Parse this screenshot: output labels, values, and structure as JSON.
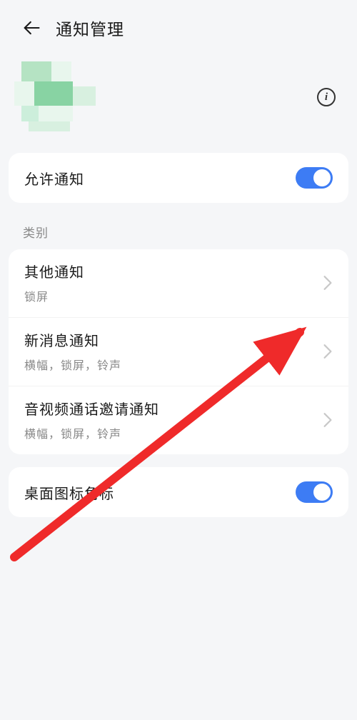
{
  "header": {
    "title": "通知管理"
  },
  "allow_notification": {
    "label": "允许通知",
    "enabled": true
  },
  "category_section_label": "类别",
  "categories": [
    {
      "title": "其他通知",
      "sub": "锁屏"
    },
    {
      "title": "新消息通知",
      "sub": "横幅，锁屏，铃声"
    },
    {
      "title": "音视频通话邀请通知",
      "sub": "横幅，锁屏，铃声"
    }
  ],
  "badge": {
    "label": "桌面图标角标",
    "enabled": true
  }
}
